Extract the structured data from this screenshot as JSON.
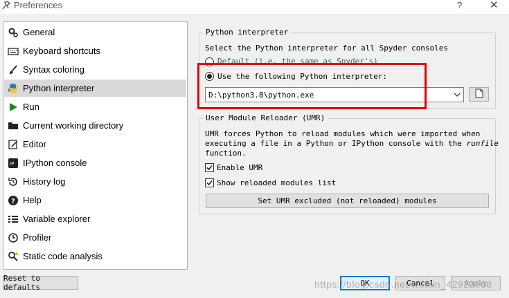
{
  "window": {
    "title": "Preferences",
    "help_label": "?",
    "close_label": "✕"
  },
  "sidebar": {
    "items": [
      {
        "label": "General",
        "icon": "gear-icon"
      },
      {
        "label": "Keyboard shortcuts",
        "icon": "keyboard-icon"
      },
      {
        "label": "Syntax coloring",
        "icon": "brush-icon"
      },
      {
        "label": "Python interpreter",
        "icon": "python-icon",
        "selected": true
      },
      {
        "label": "Run",
        "icon": "run-icon"
      },
      {
        "label": "Current working directory",
        "icon": "folder-icon"
      },
      {
        "label": "Editor",
        "icon": "editor-icon"
      },
      {
        "label": "IPython console",
        "icon": "ipython-icon"
      },
      {
        "label": "History log",
        "icon": "history-icon"
      },
      {
        "label": "Help",
        "icon": "help-icon"
      },
      {
        "label": "Variable explorer",
        "icon": "variable-explorer-icon"
      },
      {
        "label": "Profiler",
        "icon": "profiler-icon"
      },
      {
        "label": "Static code analysis",
        "icon": "code-analysis-icon"
      }
    ]
  },
  "python_interpreter": {
    "group_title": "Python interpreter",
    "description": "Select the Python interpreter for all Spyder consoles",
    "default_option": "Default (i.e. the same as Spyder's)",
    "custom_option": "Use the following Python interpreter:",
    "interpreter_path": "D:\\python3.8\\python.exe"
  },
  "umr": {
    "group_title": "User Module Reloader (UMR)",
    "description_line1": "UMR forces Python to reload modules which were imported when",
    "description_line2_prefix": "executing a file in a Python or IPython console with the ",
    "description_line2_italic": "runfile",
    "description_line3": "function.",
    "enable_label": "Enable UMR",
    "enable_checked": true,
    "show_label": "Show reloaded modules list",
    "show_checked": true,
    "excluded_button": "Set UMR excluded (not reloaded) modules"
  },
  "footer": {
    "reset_label": "Reset to defaults",
    "ok_label": "OK",
    "cancel_label": "Cancel",
    "apply_label": "Apply"
  },
  "watermark": "https://blog.csdn.net/weixin_42923968",
  "colors": {
    "highlight_box": "#e00000",
    "selected_item": "#d9d9d9"
  }
}
